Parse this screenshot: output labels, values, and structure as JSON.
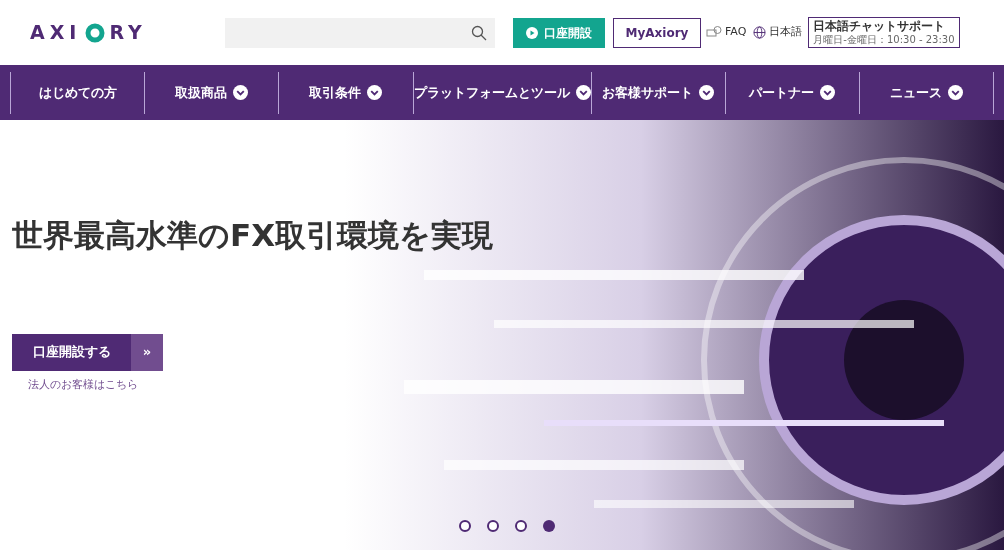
{
  "logo": {
    "left": "AXI",
    "right": "RY"
  },
  "header_buttons": {
    "open_account": "口座開設",
    "my_account": "MyAxiory",
    "faq": "FAQ",
    "language": "日本語"
  },
  "support": {
    "title": "日本語チャットサポート",
    "hours": "月曜日-金曜日：10:30 - 23:30"
  },
  "nav": [
    {
      "label": "はじめての方",
      "dropdown": false
    },
    {
      "label": "取扱商品",
      "dropdown": true
    },
    {
      "label": "取引条件",
      "dropdown": true
    },
    {
      "label": "プラットフォームとツール",
      "dropdown": true
    },
    {
      "label": "お客様サポート",
      "dropdown": true
    },
    {
      "label": "パートナー",
      "dropdown": true
    },
    {
      "label": "ニュース",
      "dropdown": true
    }
  ],
  "hero": {
    "headline": "世界最高水準のFX取引環境を実現",
    "cta": "口座開設する",
    "cta_arrow": "»",
    "corporate_link": "法人のお客様はこちら"
  },
  "slides": [
    {
      "selected": false
    },
    {
      "selected": false
    },
    {
      "selected": false
    },
    {
      "selected": true
    }
  ]
}
